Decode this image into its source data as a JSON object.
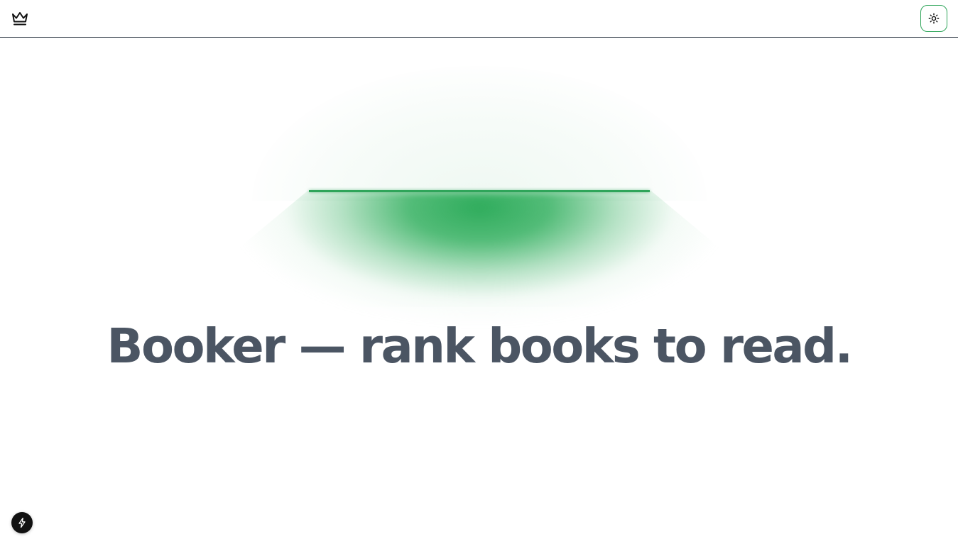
{
  "header": {
    "logo_icon": "crown-icon",
    "theme_toggle_icon": "sun-icon"
  },
  "hero": {
    "headline": "Booker — rank books to read."
  },
  "dev_badge": {
    "icon": "lightning-bolt-icon"
  },
  "colors": {
    "accent": "#2fa55a",
    "headline": "#4b5563",
    "border": "#1f2937",
    "badge_bg": "#111111"
  }
}
